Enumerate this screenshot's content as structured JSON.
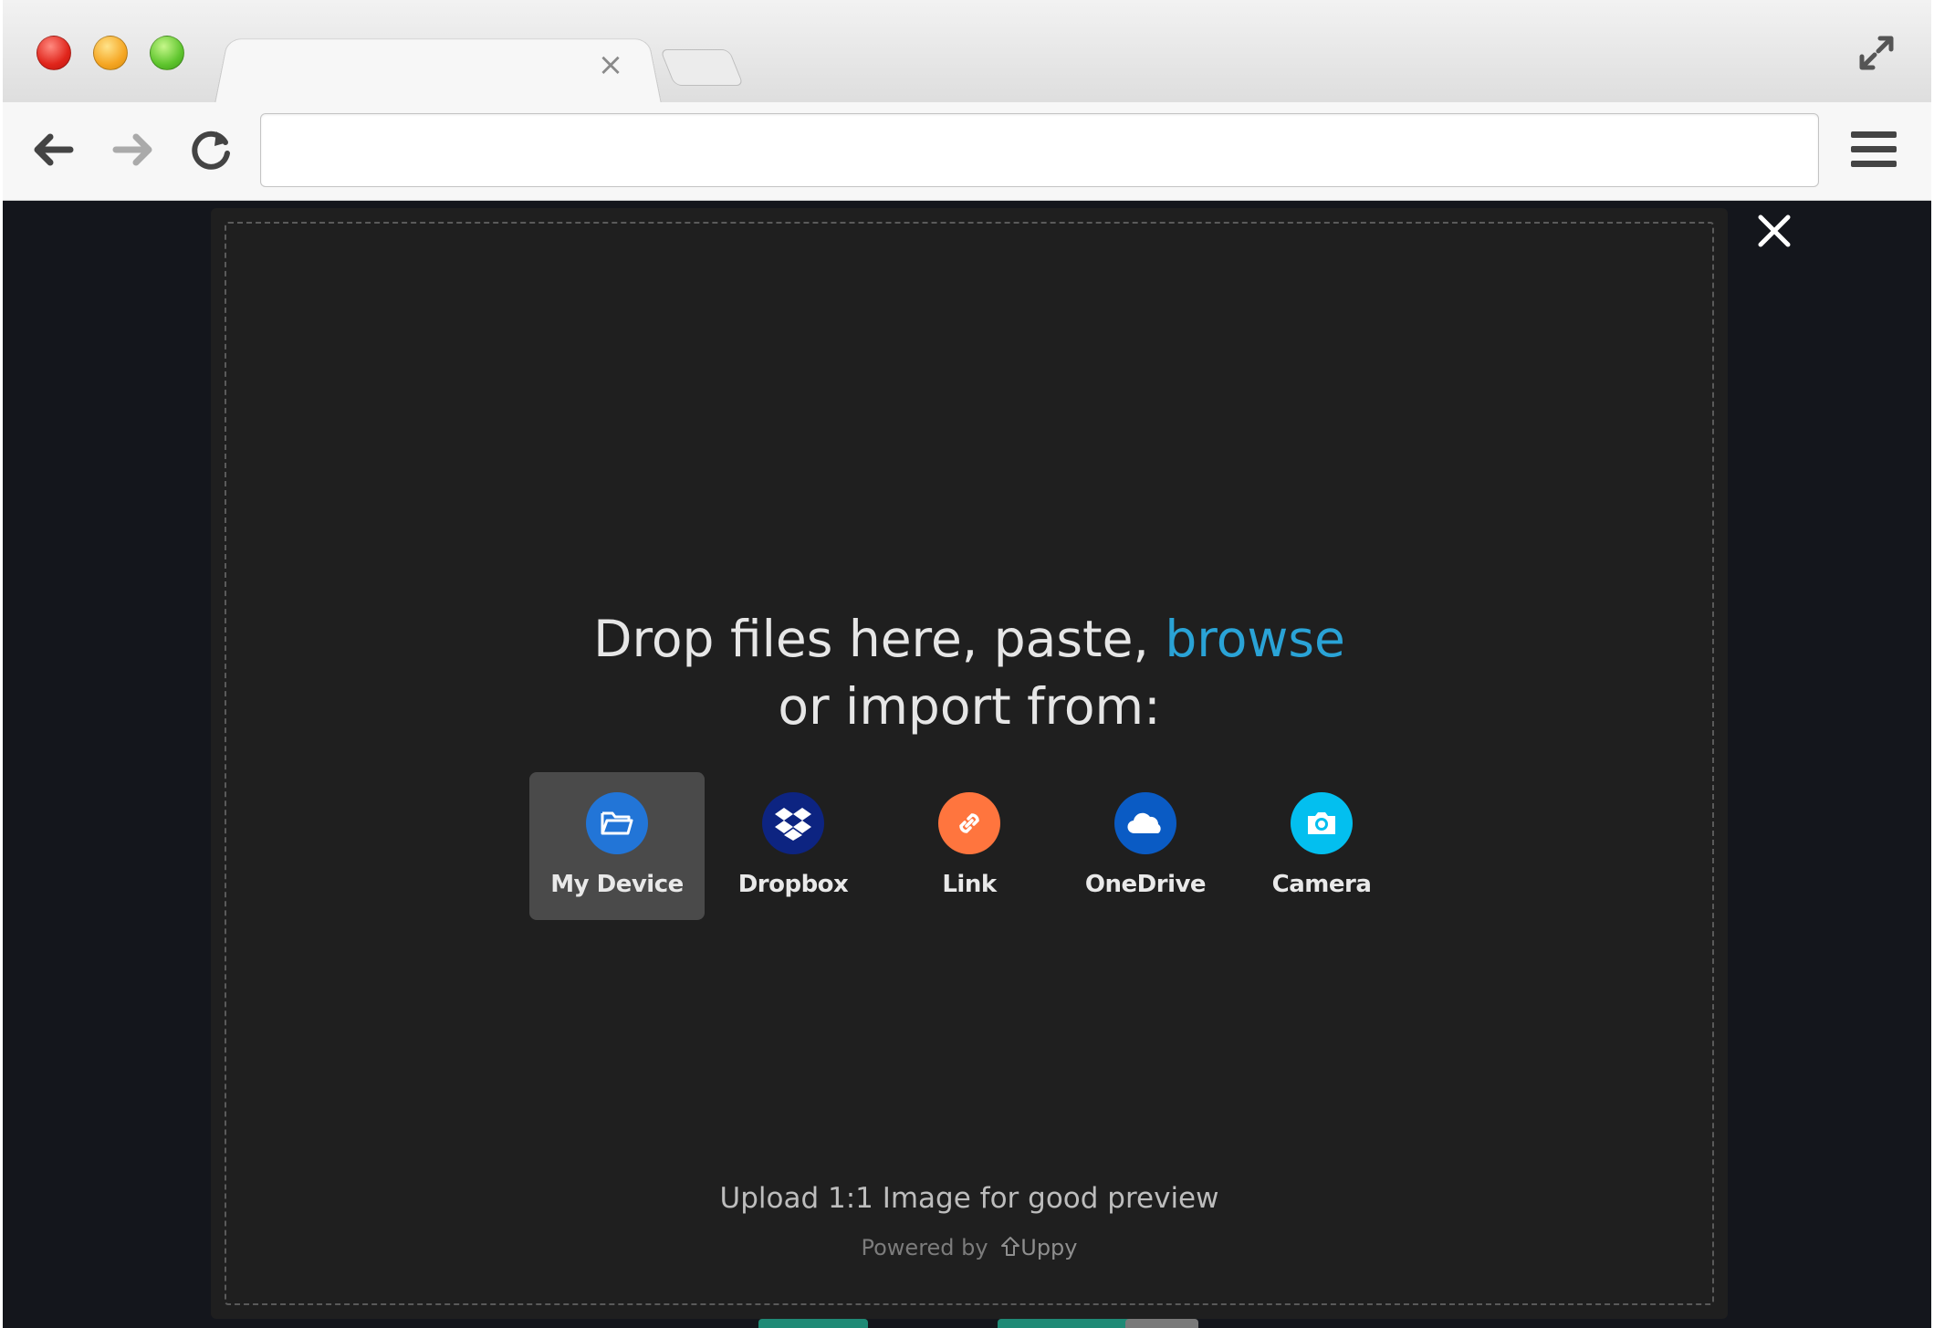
{
  "browser": {
    "tab_close_glyph": "×",
    "address_value": "",
    "icons": {
      "back": "back-arrow-icon",
      "forward": "forward-arrow-icon",
      "reload": "reload-icon",
      "menu": "hamburger-menu-icon",
      "fullscreen": "fullscreen-icon"
    }
  },
  "uploader": {
    "close_icon": "close-icon",
    "headline_line1": "Drop files here, paste, ",
    "browse_link": "browse",
    "headline_line2": "or import from:",
    "sources": [
      {
        "label": "My Device",
        "icon": "folder-icon",
        "color": "#2275d7",
        "active": true
      },
      {
        "label": "Dropbox",
        "icon": "dropbox-icon",
        "color": "#0d2481",
        "active": false
      },
      {
        "label": "Link",
        "icon": "link-icon",
        "color": "#ff753e",
        "active": false
      },
      {
        "label": "OneDrive",
        "icon": "onedrive-icon",
        "color": "#0a5bc4",
        "active": false
      },
      {
        "label": "Camera",
        "icon": "camera-icon",
        "color": "#03bfef",
        "active": false
      }
    ],
    "note": "Upload 1:1 Image for good preview",
    "powered_by": "Powered by",
    "brand": "Uppy"
  },
  "colors": {
    "accent": "#2aa3d6",
    "modal_bg": "#1f1f1f",
    "page_bg": "#14161c"
  }
}
